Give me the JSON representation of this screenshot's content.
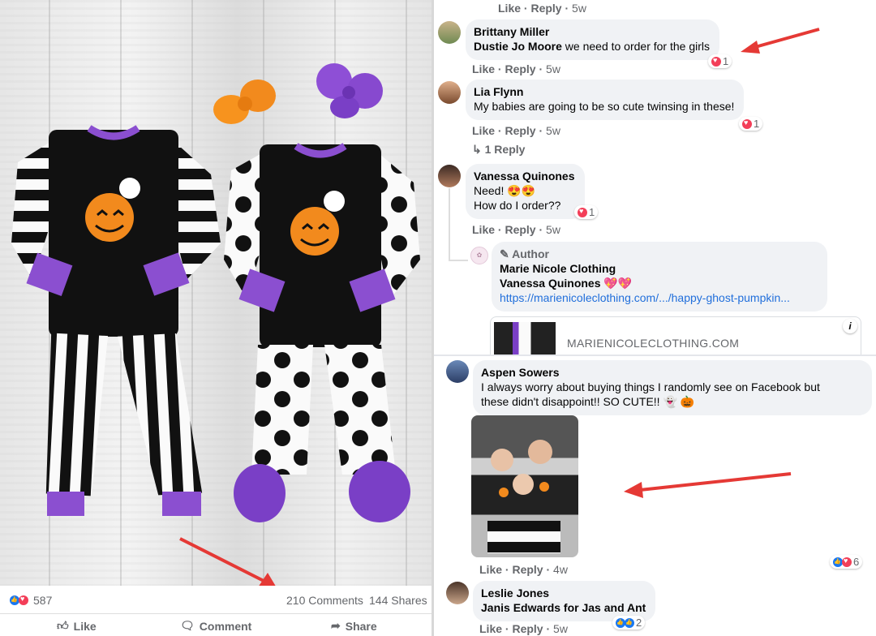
{
  "post": {
    "reactions_count": "587",
    "comments": "210 Comments",
    "shares": "144 Shares",
    "actions": {
      "like": "Like",
      "comment": "Comment",
      "share": "Share"
    }
  },
  "top_meta": {
    "like": "Like",
    "reply": "Reply",
    "age": "5w"
  },
  "comments": [
    {
      "name": "Brittany Miller",
      "tag": "Dustie Jo Moore",
      "text": " we need to order for the girls",
      "reactions": "1",
      "like": "Like",
      "reply": "Reply",
      "age": "5w"
    },
    {
      "name": "Lia Flynn",
      "text": "My babies are going to be so cute twinsing in these!",
      "reactions": "1",
      "like": "Like",
      "reply": "Reply",
      "age": "5w",
      "replies": "1 Reply"
    },
    {
      "name": "Vanessa Quinones",
      "line1": "Need! 😍😍",
      "line2": "How do I order??",
      "reactions": "1",
      "like": "Like",
      "reply": "Reply",
      "age": "5w"
    }
  ],
  "author_reply": {
    "badge": "Author",
    "name": "Marie Nicole Clothing",
    "tag": "Vanessa Quinones",
    "tag_emoji": "💖💖",
    "link": "https://marienicoleclothing.com/.../happy-ghost-pumpkin...",
    "preview_domain": "MARIENICOLECLOTHING.COM",
    "info_icon": "i"
  },
  "lower_comments": [
    {
      "name": "Aspen Sowers",
      "line1": "I always worry about buying things I randomly see on Facebook but",
      "line2": "these didn't disappoint!! SO CUTE!! 👻 🎃",
      "reactions": "6",
      "like": "Like",
      "reply": "Reply",
      "age": "4w"
    },
    {
      "name": "Leslie Jones",
      "text": "Janis Edwards for Jas and Ant",
      "reactions": "2",
      "like": "Like",
      "reply": "Reply",
      "age": "5w"
    }
  ],
  "colors": {
    "accent": "#1877f2",
    "love": "#f33e58",
    "arrow": "#e53935",
    "purple": "#7a3fc6",
    "orange": "#f28a1d"
  }
}
